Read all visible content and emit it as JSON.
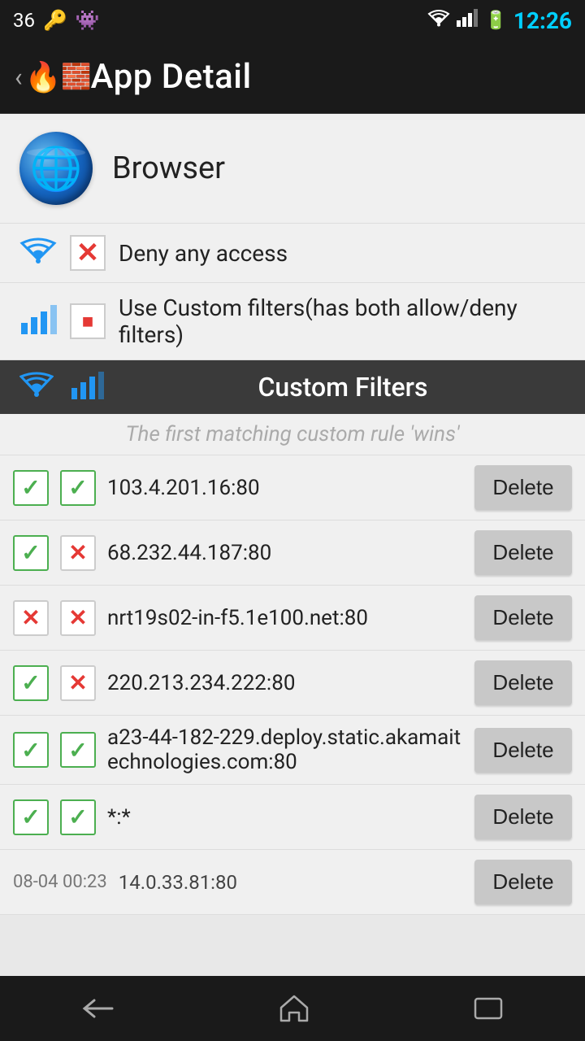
{
  "statusBar": {
    "battery_num": "36",
    "time": "12:26"
  },
  "appBar": {
    "title": "App Detail"
  },
  "browser": {
    "name": "Browser"
  },
  "accessOptions": [
    {
      "label": "Deny any access",
      "wifiChecked": false,
      "dataChecked": false,
      "checkType": "x"
    },
    {
      "label": "Use Custom filters(has both allow/deny filters)",
      "wifiChecked": true,
      "dataChecked": true,
      "checkType": "dot"
    }
  ],
  "customFilters": {
    "header": "Custom Filters",
    "hint": "The first matching custom rule 'wins'"
  },
  "filterRows": [
    {
      "wifiAllow": true,
      "dataAllow": true,
      "address": "103.4.201.16:80"
    },
    {
      "wifiAllow": true,
      "dataAllow": false,
      "address": "68.232.44.187:80"
    },
    {
      "wifiAllow": false,
      "dataAllow": false,
      "address": "nrt19s02-in-f5.1e100.net:80"
    },
    {
      "wifiAllow": true,
      "dataAllow": false,
      "address": "220.213.234.222:80"
    },
    {
      "wifiAllow": true,
      "dataAllow": true,
      "address": "a23-44-182-229.deploy.static.akamaitechnologies.com:80"
    },
    {
      "wifiAllow": true,
      "dataAllow": true,
      "address": "*:*"
    }
  ],
  "partialRow": {
    "date": "08-04 00:23",
    "address": "14.0.33.81:80",
    "deleteLabel": "Delete"
  },
  "deleteLabel": "Delete",
  "nav": {
    "back": "←",
    "home": "⌂",
    "recents": "▭"
  }
}
